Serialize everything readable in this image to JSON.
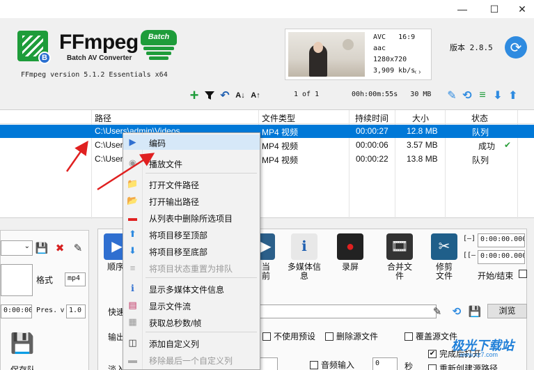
{
  "window": {
    "minimize_glyph": "—",
    "maximize_glyph": "☐",
    "close_glyph": "✕"
  },
  "header": {
    "logo_badge": "B",
    "brand": "FFmpeg",
    "brand_sub": "Batch AV Converter",
    "batch_badge": "Batch",
    "ffmpeg_version": "FFmpeg version 5.1.2 Essentials  x64",
    "app_version": "版本 2.8.5"
  },
  "media_info": {
    "codec": "AVC",
    "aspect": "16:9",
    "audio": "aac",
    "resolution": "1280x720",
    "bitrate": "3,909 kb/s",
    "nav_arrows": "‹ ›"
  },
  "toolbar": {
    "page_info": "1 of 1",
    "total_duration": "00h:00m:55s",
    "total_size": "30 MB"
  },
  "table": {
    "columns": [
      "路径",
      "文件类型",
      "持续时间",
      "大小",
      "状态"
    ],
    "rows": [
      {
        "path": "C:\\Users\\admin\\Videos",
        "type": "MP4 视频",
        "duration": "00:00:27",
        "size": "12.8 MB",
        "status": "队列",
        "selected": true
      },
      {
        "path": "C:\\User",
        "type": "MP4 视频",
        "duration": "00:00:06",
        "size": "3.57 MB",
        "status": "成功",
        "selected": false
      },
      {
        "path": "C:\\User",
        "type": "MP4 视频",
        "duration": "00:00:22",
        "size": "13.8 MB",
        "status": "队列",
        "selected": false
      }
    ]
  },
  "bottom": {
    "format_label": "格式",
    "format_value": "mp4",
    "time_value": "0:00:00.000",
    "preset_label": "Pres.",
    "version_value": "1.0",
    "save_queue": "保存队",
    "sequence_label": "顺序",
    "quick_label": "快速",
    "output_label": "输出",
    "in_label": "淡入",
    "buttons": {
      "current": "当\n前",
      "media_info": "多媒体信\n息",
      "record": "录屏",
      "merge": "合并文\n件",
      "trim": "修剪\n文件"
    },
    "start_end": "开始/结束",
    "range_start_label": "[—]",
    "range_end_label": "[[—",
    "range_start": "0:00:00.000",
    "range_end": "0:00:00.000",
    "browse": "浏览",
    "no_preset": "不使用预设",
    "delete_source": "删除源文件",
    "overwrite": "覆盖源文件",
    "open_after": "完成后打开",
    "recreate_source": "重新创建源路径",
    "audio_input": "音频输入",
    "seconds_value": "0",
    "seconds_unit": "秒"
  },
  "context_menu": {
    "items": [
      {
        "label": "编码",
        "icon": "play-icon",
        "disabled": false
      },
      {
        "label": "播放文件",
        "icon": "play-file-icon",
        "disabled": false
      },
      {
        "label": "打开文件路径",
        "icon": "folder-icon",
        "disabled": false
      },
      {
        "label": "打开输出路径",
        "icon": "folder-open-icon",
        "disabled": false
      },
      {
        "label": "从列表中删除所选项目",
        "icon": "minus-icon",
        "disabled": false
      },
      {
        "label": "将项目移至顶部",
        "icon": "arrow-up-icon",
        "disabled": false
      },
      {
        "label": "将项目移至底部",
        "icon": "arrow-down-icon",
        "disabled": false
      },
      {
        "label": "将项目状态重置为排队",
        "icon": "list-icon",
        "disabled": true
      },
      {
        "label": "显示多媒体文件信息",
        "icon": "media-info-icon",
        "disabled": false
      },
      {
        "label": "显示文件流",
        "icon": "streams-icon",
        "disabled": false
      },
      {
        "label": "获取总秒数/帧",
        "icon": "calculator-icon",
        "disabled": false
      },
      {
        "label": "添加自定义列",
        "icon": "column-add-icon",
        "disabled": false
      },
      {
        "label": "移除最后一个自定义列",
        "icon": "column-remove-icon",
        "disabled": true
      }
    ]
  },
  "watermark": {
    "text": "极光下载站",
    "url": "www.xz7.com"
  },
  "colors": {
    "selection": "#0078d7",
    "brand_green": "#1e9c3a",
    "accent_blue": "#2f8be0",
    "arrow_red": "#e02020"
  }
}
